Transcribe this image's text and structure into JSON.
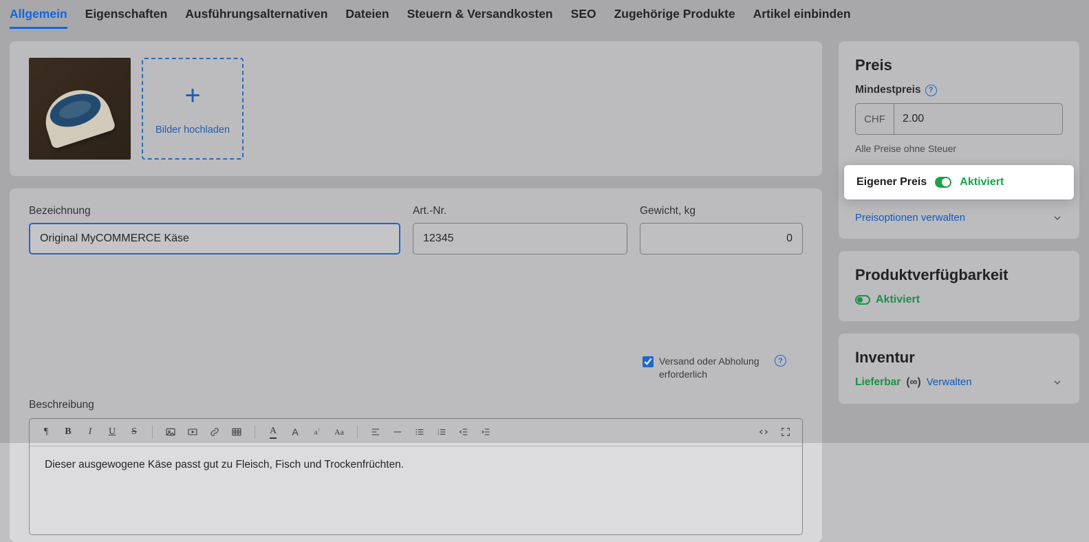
{
  "tabs": {
    "items": [
      {
        "label": "Allgemein",
        "active": true
      },
      {
        "label": "Eigenschaften"
      },
      {
        "label": "Ausführungsalternativen"
      },
      {
        "label": "Dateien"
      },
      {
        "label": "Steuern & Versandkosten"
      },
      {
        "label": "SEO"
      },
      {
        "label": "Zugehörige Produkte"
      },
      {
        "label": "Artikel einbinden"
      }
    ]
  },
  "images": {
    "upload_label": "Bilder hochladen"
  },
  "fields": {
    "name": {
      "label": "Bezeichnung",
      "value": "Original MyCOMMERCE Käse"
    },
    "sku": {
      "label": "Art.-Nr.",
      "value": "12345"
    },
    "weight": {
      "label": "Gewicht, kg",
      "value": "0"
    },
    "shipping_required": {
      "checked": true,
      "label": "Versand oder Abholung erforderlich"
    }
  },
  "description": {
    "label": "Beschreibung",
    "body": "Dieser ausgewogene Käse passt gut zu Fleisch, Fisch und Trockenfrüchten."
  },
  "price_panel": {
    "heading": "Preis",
    "min_label": "Mindestpreis",
    "currency": "CHF",
    "value": "2.00",
    "note": "Alle Preise ohne Steuer",
    "own_price_label": "Eigener Preis",
    "own_price_state": "Aktiviert",
    "options_link": "Preisoptionen verwalten"
  },
  "availability_panel": {
    "heading": "Produktverfügbarkeit",
    "state": "Aktiviert"
  },
  "inventory_panel": {
    "heading": "Inventur",
    "stock": "Lieferbar",
    "infinity": "(∞)",
    "manage": "Verwalten"
  },
  "colors": {
    "accent": "#1570ef",
    "success": "#17a34a",
    "link": "#0560d6"
  }
}
